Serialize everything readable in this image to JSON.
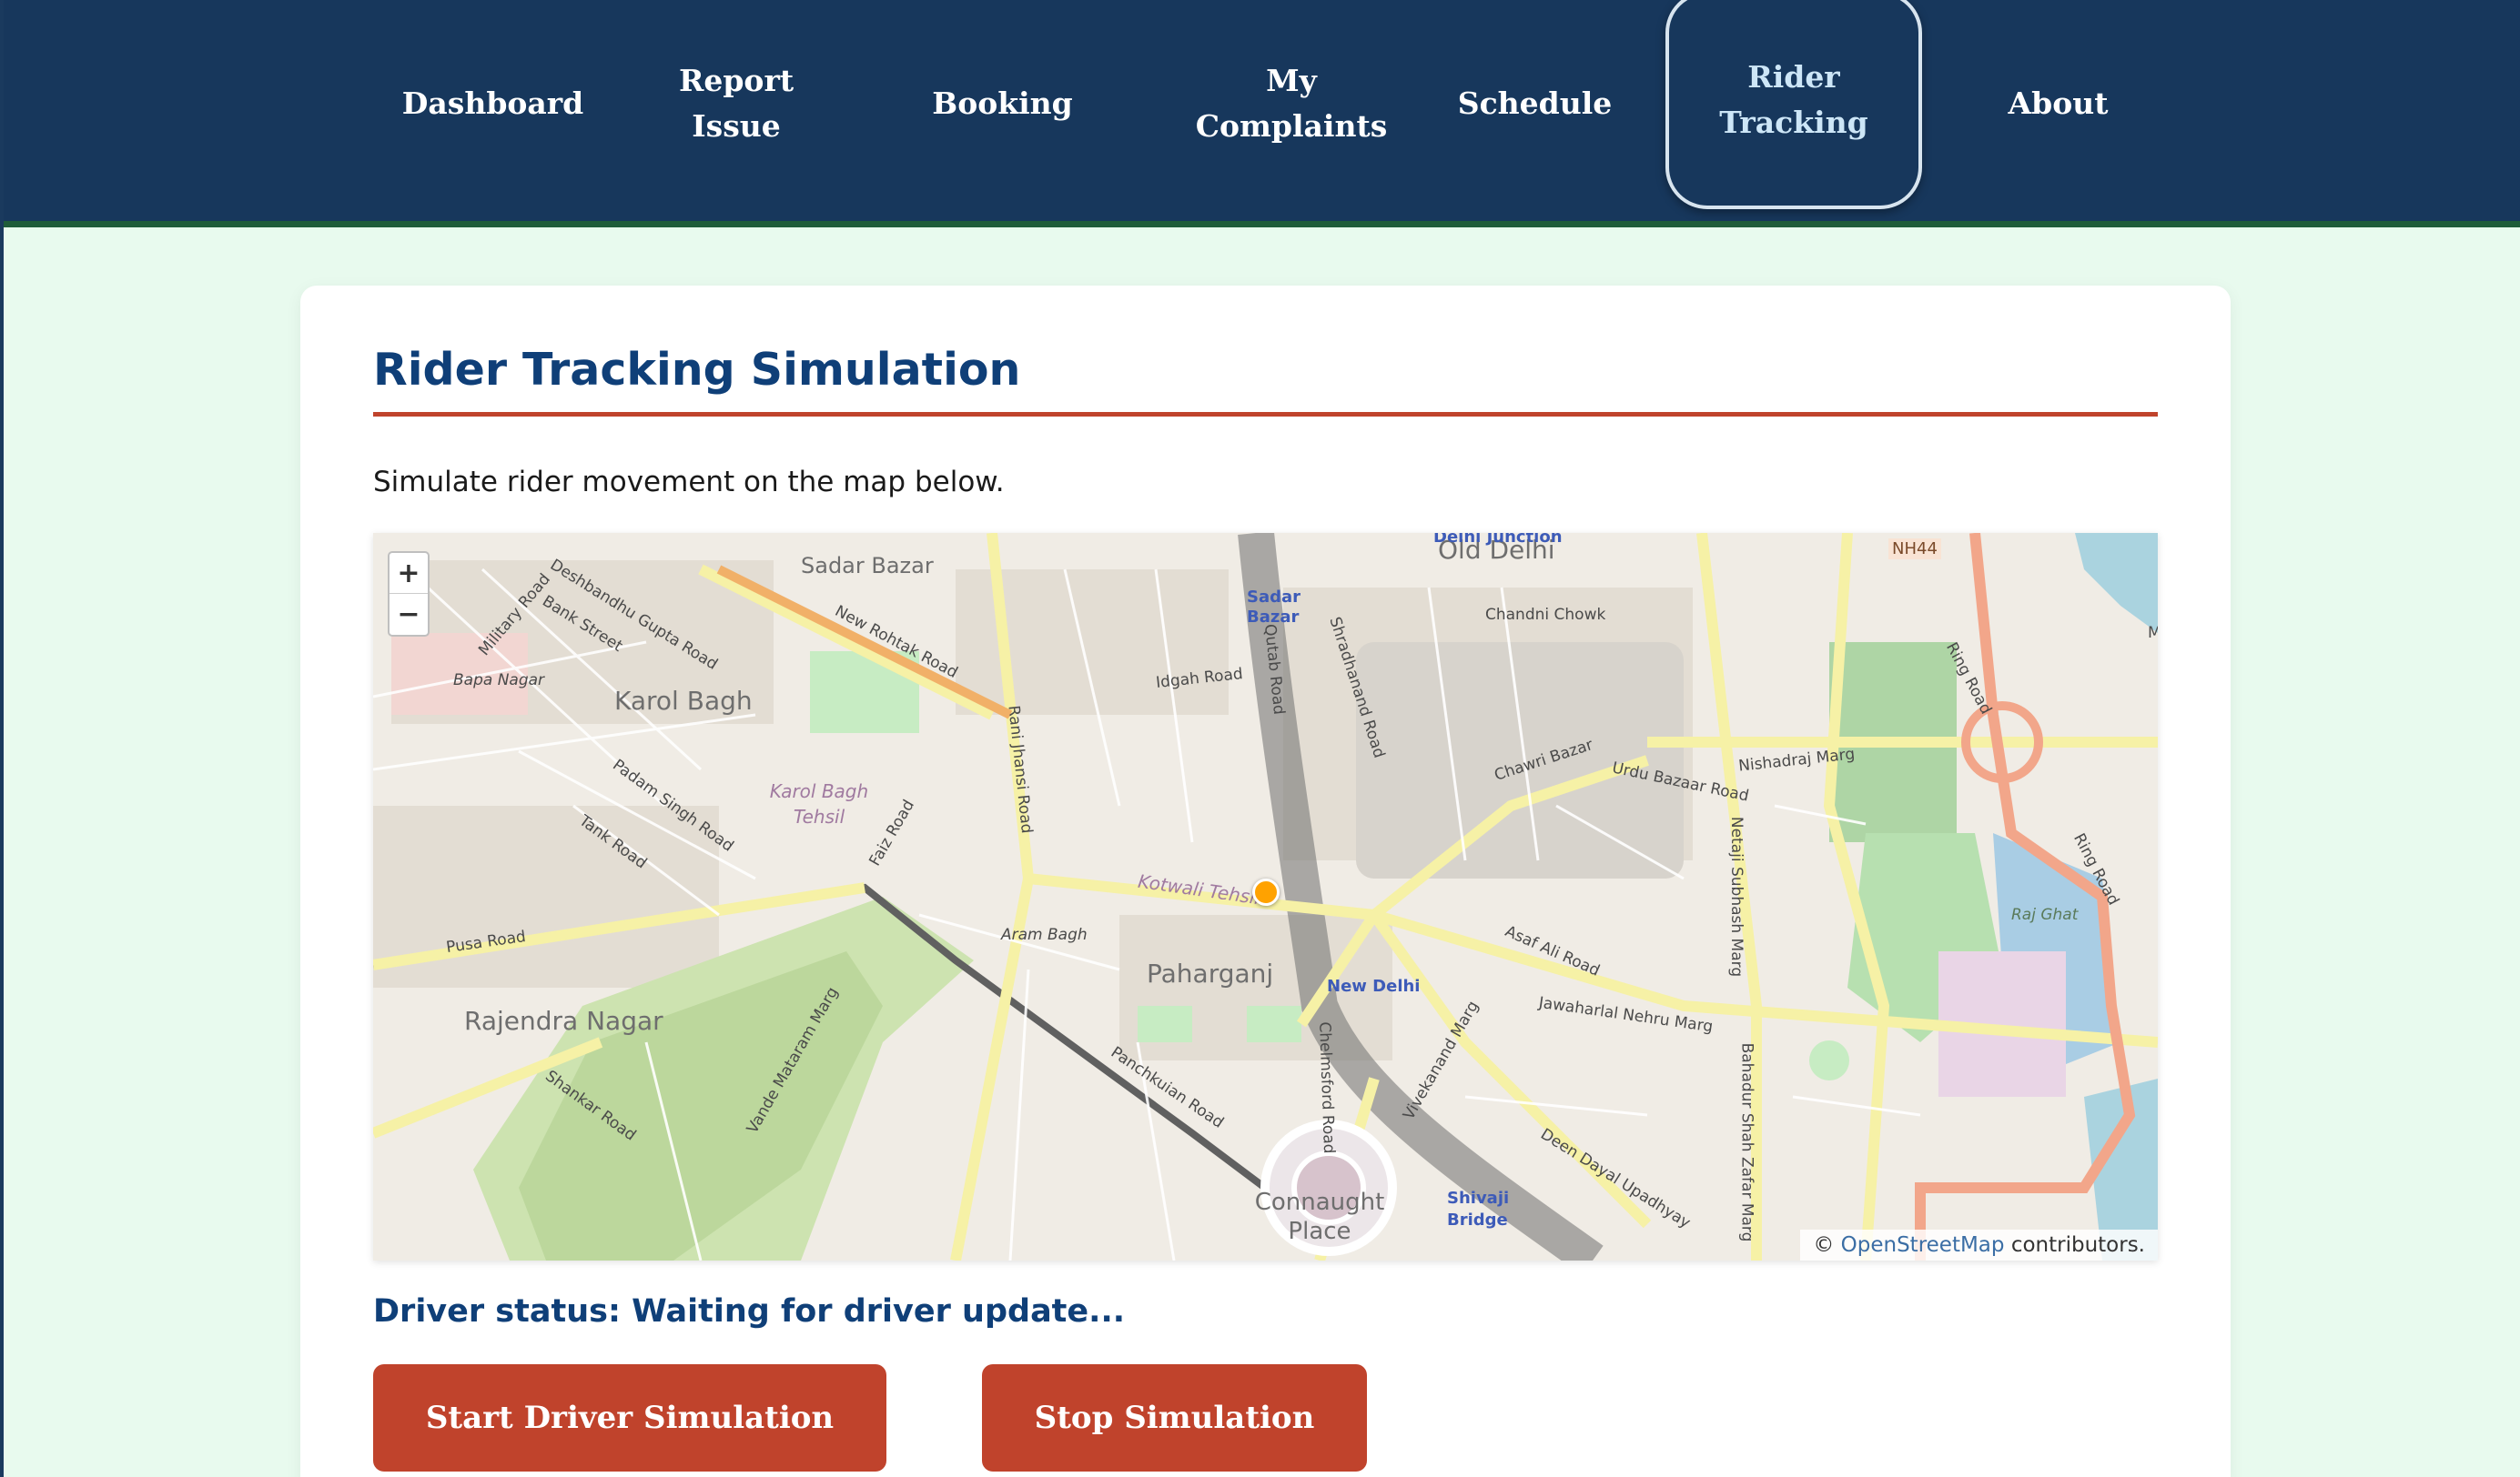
{
  "nav": {
    "items": [
      {
        "label": "Dashboard"
      },
      {
        "label": "Report Issue"
      },
      {
        "label": "Booking"
      },
      {
        "label": "My Complaints"
      },
      {
        "label": "Schedule"
      },
      {
        "label": "Rider Tracking",
        "active": true
      },
      {
        "label": "About"
      }
    ]
  },
  "page": {
    "title": "Rider Tracking Simulation",
    "intro": "Simulate rider movement on the map below."
  },
  "map": {
    "zoom_in": "+",
    "zoom_out": "−",
    "attribution_prefix": "©",
    "attribution_link": "OpenStreetMap",
    "attribution_suffix": "contributors.",
    "labels": {
      "old_delhi": "Old Delhi",
      "karol_bagh": "Karol Bagh",
      "paharganj": "Paharganj",
      "rajendra_nagar": "Rajendra Nagar",
      "connaught_place": "Connaught Place",
      "new_delhi": "New Delhi",
      "sadar_bazar": "Sadar Bazar",
      "karol_bagh_tehsil": "Karol Bagh Tehsil",
      "raj_ghat": "Raj Ghat",
      "kotwali_tehsil": "Kotwali Tehsil",
      "aram_bagh": "Aram Bagh",
      "bapa_nagar": "Bapa Nagar",
      "chandni_chowk": "Chandni Chowk",
      "chawri_bazar": "Chawri Bazar",
      "urdu_bazaar_road": "Urdu Bazaar Road",
      "nishadraj_marg": "Nishadraj Marg",
      "asaf_ali_road": "Asaf Ali Road",
      "jawaharlal_nehru_marg": "Jawaharlal Nehru Marg",
      "pusa_road": "Pusa Road",
      "new_rohtak_road": "New Rohtak Road",
      "idgah_road": "Idgah Road",
      "shivaji_bridge": "Shivaji Bridge",
      "nh44": "NH44",
      "ring_road": "Ring Road",
      "panchkuian_road": "Panchkuian Road",
      "shankar_road": "Shankar Road",
      "deen_dayal": "Deen Dayal Upadhyay",
      "sadar_bazar_station": "Sadar Bazar",
      "old_delhi_junction": "Delhi Junction",
      "padam_singh_road": "Padam Singh Road",
      "tank_road": "Tank Road",
      "deshbandhu_gupta_road": "Deshbandhu Gupta Road",
      "bank_street": "Bank Street",
      "military_road": "Military Road",
      "vande_mataram_marg": "Vande Mataram Marg",
      "chelmsford_road": "Chelmsford Road",
      "vivekanand_marg": "Vivekanand Marg",
      "faiz_road": "Faiz Road",
      "rani_jhansi_road": "Rani Jhansi Road",
      "qutab_road": "Qutab Road",
      "shradhanand_road": "Shradhanand Road",
      "mahatma_gandhi_marg": "Mahatma Gandhi Marg",
      "netaji_subhash_marg": "Netaji Subhash Marg",
      "bahadur_shah_zafar_marg": "Bahadur Shah Zafar Marg"
    },
    "marker": "rider-location"
  },
  "status": {
    "text": "Driver status: Waiting for driver update..."
  },
  "buttons": {
    "start": "Start Driver Simulation",
    "stop": "Stop Simulation"
  },
  "colors": {
    "nav_bg": "#17375c",
    "page_bg": "#e8faee",
    "accent": "#c0432c",
    "title": "#0f3f78",
    "marker": "#ffa200"
  }
}
